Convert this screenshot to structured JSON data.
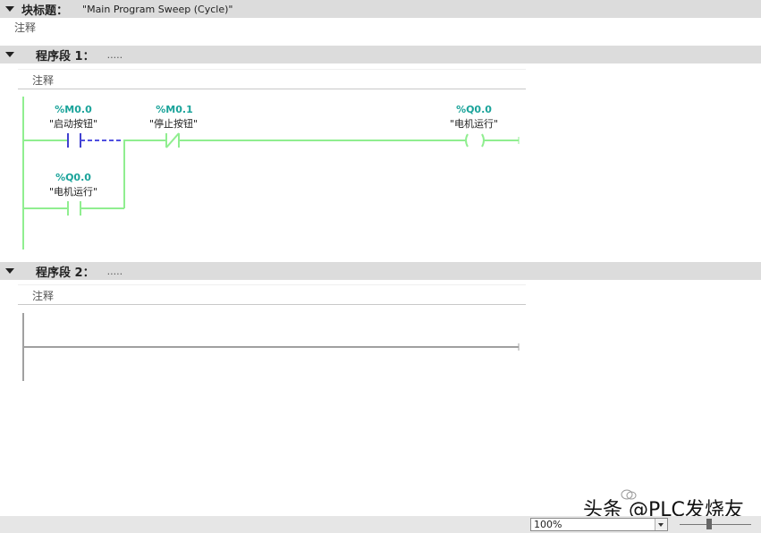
{
  "block_header": {
    "label": "块标题：",
    "value": "\"Main Program Sweep (Cycle)\"",
    "comment": "注释"
  },
  "networks": [
    {
      "title": "程序段 1：",
      "dots": ".....",
      "comment": "注释",
      "contacts": [
        {
          "address": "%M0.0",
          "symbol": "\"启动按钮\"",
          "type": "normally-open"
        },
        {
          "address": "%M0.1",
          "symbol": "\"停止按钮\"",
          "type": "normally-closed"
        },
        {
          "address": "%Q0.0",
          "symbol": "\"电机运行\"",
          "type": "normally-open"
        }
      ],
      "coil": {
        "address": "%Q0.0",
        "symbol": "\"电机运行\""
      }
    },
    {
      "title": "程序段 2：",
      "dots": ".....",
      "comment": "注释"
    }
  ],
  "status_bar": {
    "zoom": "100%"
  },
  "watermark": "头条 @PLC发烧友",
  "colors": {
    "power_rail": "#90ee90",
    "address": "#1aa39a",
    "empty_rung": "#a0a0a0",
    "header_bg": "#dcdcdc"
  }
}
